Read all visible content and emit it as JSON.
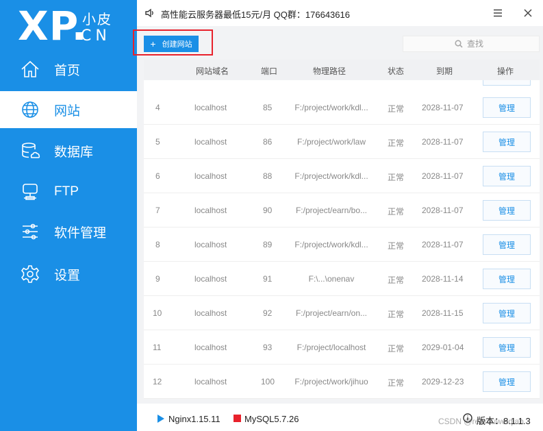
{
  "logo": {
    "main": "XP.",
    "top": "小皮",
    "bottom": "CN"
  },
  "sidebar": {
    "items": [
      {
        "label": "首页",
        "icon": "home-icon"
      },
      {
        "label": "网站",
        "icon": "globe-icon",
        "active": true
      },
      {
        "label": "数据库",
        "icon": "database-icon"
      },
      {
        "label": "FTP",
        "icon": "server-icon"
      },
      {
        "label": "软件管理",
        "icon": "sliders-icon"
      },
      {
        "label": "设置",
        "icon": "gear-icon"
      }
    ]
  },
  "topbar": {
    "announcement": "高性能云服务器最低15元/月  QQ群：176643616",
    "speaker_icon": "speaker-icon",
    "minimize_icon": "menu-icon",
    "close_icon": "close-icon"
  },
  "toolbar": {
    "create_label": "创建网站",
    "search_placeholder": "查找"
  },
  "table": {
    "headers": [
      "网站域名",
      "端口",
      "物理路径",
      "状态",
      "到期",
      "操作"
    ],
    "rows": [
      {
        "id": "4",
        "domain": "localhost",
        "port": "85",
        "path": "F:/project/work/kdl...",
        "status": "正常",
        "expire": "2028-11-07",
        "action": "管理"
      },
      {
        "id": "5",
        "domain": "localhost",
        "port": "86",
        "path": "F:/project/work/law",
        "status": "正常",
        "expire": "2028-11-07",
        "action": "管理"
      },
      {
        "id": "6",
        "domain": "localhost",
        "port": "88",
        "path": "F:/project/work/kdl...",
        "status": "正常",
        "expire": "2028-11-07",
        "action": "管理"
      },
      {
        "id": "7",
        "domain": "localhost",
        "port": "90",
        "path": "F:/project/earn/bo...",
        "status": "正常",
        "expire": "2028-11-07",
        "action": "管理"
      },
      {
        "id": "8",
        "domain": "localhost",
        "port": "89",
        "path": "F:/project/work/kdl...",
        "status": "正常",
        "expire": "2028-11-07",
        "action": "管理"
      },
      {
        "id": "9",
        "domain": "localhost",
        "port": "91",
        "path": "F:\\...\\onenav",
        "status": "正常",
        "expire": "2028-11-14",
        "action": "管理"
      },
      {
        "id": "10",
        "domain": "localhost",
        "port": "92",
        "path": "F:/project/earn/on...",
        "status": "正常",
        "expire": "2028-11-15",
        "action": "管理"
      },
      {
        "id": "11",
        "domain": "localhost",
        "port": "93",
        "path": "F:/project/localhost",
        "status": "正常",
        "expire": "2029-01-04",
        "action": "管理"
      },
      {
        "id": "12",
        "domain": "localhost",
        "port": "100",
        "path": "F:/project/work/jihuo",
        "status": "正常",
        "expire": "2029-12-23",
        "action": "管理"
      }
    ]
  },
  "bottombar": {
    "nginx": "Nginx1.15.11",
    "mysql": "MySQL5.7.26",
    "version": "版本：8.1.1.3",
    "watermark": "CSDN @renrouweiqian"
  },
  "colors": {
    "accent": "#1a8fe6",
    "highlight": "#e8212b",
    "table_header": "#f0f1f3"
  }
}
